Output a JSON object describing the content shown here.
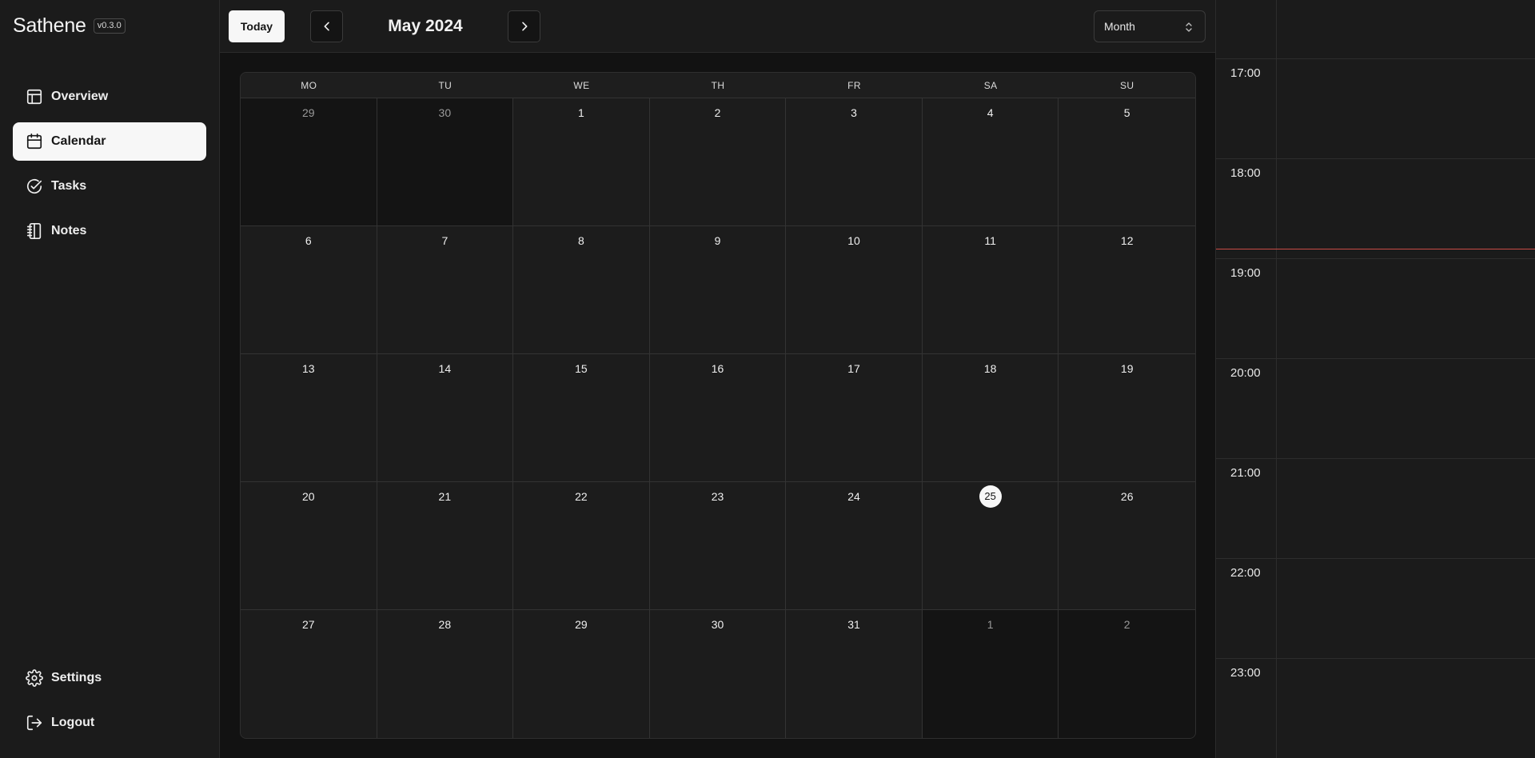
{
  "app": {
    "name": "Sathene",
    "version": "v0.3.0"
  },
  "sidebar": {
    "items": [
      {
        "label": "Overview",
        "icon": "layout-icon",
        "active": false
      },
      {
        "label": "Calendar",
        "icon": "calendar-icon",
        "active": true
      },
      {
        "label": "Tasks",
        "icon": "check-circle-icon",
        "active": false
      },
      {
        "label": "Notes",
        "icon": "notebook-icon",
        "active": false
      }
    ],
    "bottom_items": [
      {
        "label": "Settings",
        "icon": "gear-icon"
      },
      {
        "label": "Logout",
        "icon": "logout-icon"
      }
    ]
  },
  "toolbar": {
    "today_label": "Today",
    "month_title": "May 2024",
    "view_select": "Month"
  },
  "calendar": {
    "weekdays": [
      "MO",
      "TU",
      "WE",
      "TH",
      "FR",
      "SA",
      "SU"
    ],
    "days": [
      {
        "n": "29",
        "outside": true
      },
      {
        "n": "30",
        "outside": true
      },
      {
        "n": "1"
      },
      {
        "n": "2"
      },
      {
        "n": "3"
      },
      {
        "n": "4"
      },
      {
        "n": "5"
      },
      {
        "n": "6"
      },
      {
        "n": "7"
      },
      {
        "n": "8"
      },
      {
        "n": "9"
      },
      {
        "n": "10"
      },
      {
        "n": "11"
      },
      {
        "n": "12"
      },
      {
        "n": "13"
      },
      {
        "n": "14"
      },
      {
        "n": "15"
      },
      {
        "n": "16"
      },
      {
        "n": "17"
      },
      {
        "n": "18"
      },
      {
        "n": "19"
      },
      {
        "n": "20"
      },
      {
        "n": "21"
      },
      {
        "n": "22"
      },
      {
        "n": "23"
      },
      {
        "n": "24"
      },
      {
        "n": "25",
        "today": true
      },
      {
        "n": "26"
      },
      {
        "n": "27"
      },
      {
        "n": "28"
      },
      {
        "n": "29"
      },
      {
        "n": "30"
      },
      {
        "n": "31"
      },
      {
        "n": "1",
        "outside": true
      },
      {
        "n": "2",
        "outside": true
      }
    ]
  },
  "timeline": {
    "hours": [
      "17:00",
      "18:00",
      "19:00",
      "20:00",
      "21:00",
      "22:00",
      "23:00"
    ],
    "now_indicator_color": "#c94b45"
  },
  "colors": {
    "background": "#1b1b1b",
    "active_item": "#f7f7f7",
    "accent_now": "#c94b45"
  }
}
